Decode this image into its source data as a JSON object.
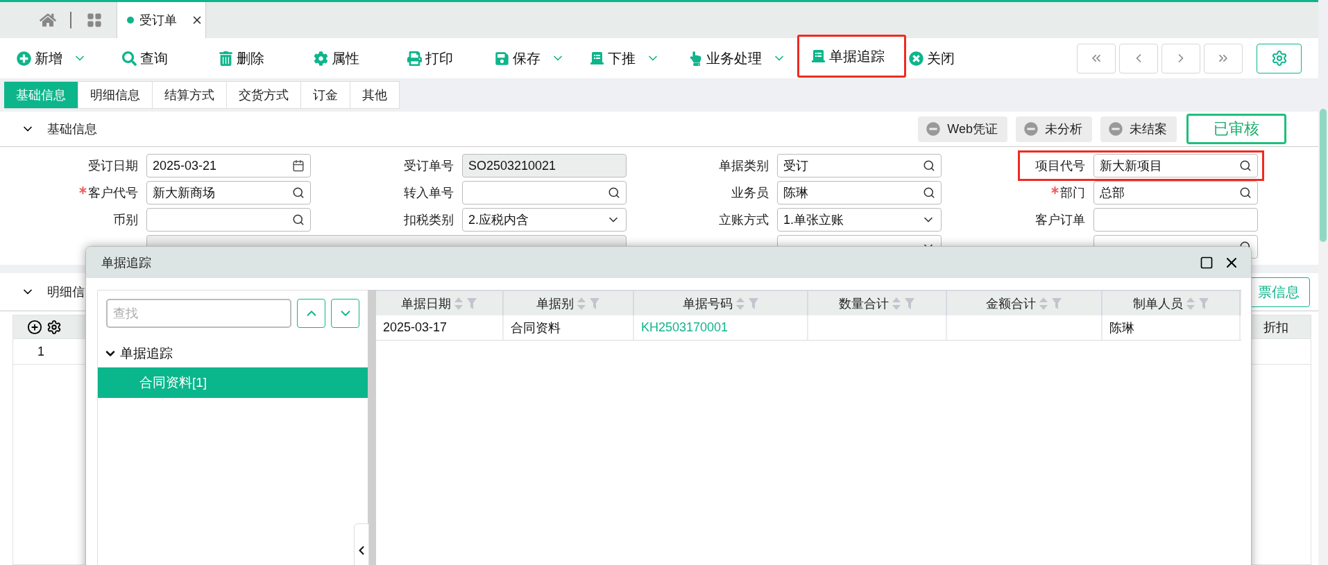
{
  "open_tabs": [
    {
      "label": "受订单",
      "selected": true
    }
  ],
  "toolbar": [
    {
      "label": "新增",
      "dropdown": true,
      "highlighted": false
    },
    {
      "label": "查询",
      "dropdown": false,
      "highlighted": false
    },
    {
      "label": "删除",
      "dropdown": false,
      "highlighted": false
    },
    {
      "label": "属性",
      "dropdown": false,
      "highlighted": false
    },
    {
      "label": "打印",
      "dropdown": false,
      "highlighted": false
    },
    {
      "label": "保存",
      "dropdown": true,
      "highlighted": false
    },
    {
      "label": "下推",
      "dropdown": true,
      "highlighted": false
    },
    {
      "label": "业务处理",
      "dropdown": true,
      "highlighted": false
    },
    {
      "label": "单据追踪",
      "dropdown": false,
      "highlighted": true
    },
    {
      "label": "关闭",
      "dropdown": false,
      "highlighted": false
    }
  ],
  "form_tabs": [
    {
      "label": "基础信息",
      "selected": true
    },
    {
      "label": "明细信息",
      "selected": false
    },
    {
      "label": "结算方式",
      "selected": false
    },
    {
      "label": "交货方式",
      "selected": false
    },
    {
      "label": "订金",
      "selected": false
    },
    {
      "label": "其他",
      "selected": false
    }
  ],
  "section": {
    "title": "基础信息",
    "expanded": true,
    "status_buttons": [
      "Web凭证",
      "未分析",
      "未结案"
    ],
    "approval": "已审核"
  },
  "fields": [
    [
      {
        "label": "受订日期",
        "value": "2025-03-21",
        "kind": "date"
      },
      {
        "label": "受订单号",
        "value": "SO2503210021",
        "kind": "readonly"
      },
      {
        "label": "单据类别",
        "value": "受订",
        "kind": "lookup"
      },
      {
        "label": "项目代号",
        "value": "新大新项目",
        "kind": "lookup",
        "highlighted": true
      }
    ],
    [
      {
        "label": "客户代号",
        "value": "新大新商场",
        "kind": "lookup",
        "required": true
      },
      {
        "label": "转入单号",
        "kind": "lookup"
      },
      {
        "label": "业务员",
        "value": "陈琳",
        "kind": "lookup"
      },
      {
        "label": "部门",
        "value": "总部",
        "kind": "lookup",
        "required": true
      }
    ],
    [
      {
        "label": "币别",
        "kind": "lookup"
      },
      {
        "label": "扣税类别",
        "value": "2.应税内含",
        "kind": "select"
      },
      {
        "label": "立账方式",
        "value": "1.单张立账",
        "kind": "select"
      },
      {
        "label": "客户订单",
        "kind": "text"
      }
    ],
    [
      {
        "kind": "wide"
      },
      {
        "kind": "select"
      },
      {
        "kind": "lookup"
      }
    ]
  ],
  "detail": {
    "title": "明细信",
    "expanded": true,
    "invoice_button": "票信息",
    "last_column": "折扣",
    "rows": [
      {
        "no": "1"
      }
    ]
  },
  "dialog": {
    "title": "单据追踪",
    "search": {
      "placeholder": "查找"
    },
    "tree": [
      {
        "label": "单据追踪",
        "expanded": true,
        "selected": false,
        "children": [
          {
            "label": "合同资料[1]",
            "selected": true
          }
        ]
      }
    ],
    "table": {
      "columns": [
        "单据日期",
        "单据别",
        "单据号码",
        "数量合计",
        "金额合计",
        "制单人员"
      ],
      "rows": [
        {
          "cells": [
            {
              "text": "2025-03-17"
            },
            {
              "text": "合同资料"
            },
            {
              "text": "KH2503170001",
              "link": true
            },
            {},
            {},
            {
              "text": "陈琳"
            }
          ]
        }
      ]
    }
  }
}
